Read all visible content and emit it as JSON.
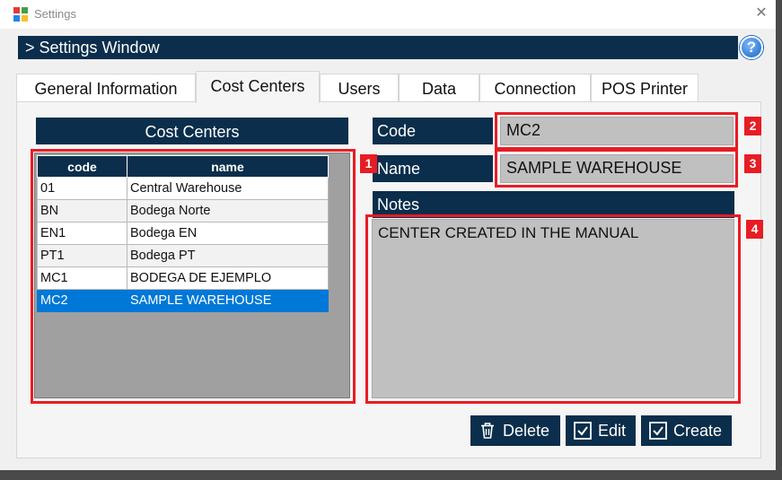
{
  "window": {
    "title": "Settings",
    "close_glyph": "✕"
  },
  "header": {
    "title": "> Settings Window",
    "help_label": "?"
  },
  "tabs": [
    {
      "label": "General Information"
    },
    {
      "label": "Cost Centers"
    },
    {
      "label": "Users"
    },
    {
      "label": "Data"
    },
    {
      "label": "Connection"
    },
    {
      "label": "POS Printer"
    }
  ],
  "active_tab": "Cost Centers",
  "cost_centers": {
    "title": "Cost Centers",
    "columns": [
      "code",
      "name"
    ],
    "rows": [
      {
        "code": "01",
        "name": "Central Warehouse"
      },
      {
        "code": "BN",
        "name": "Bodega Norte"
      },
      {
        "code": "EN1",
        "name": "Bodega EN"
      },
      {
        "code": "PT1",
        "name": "Bodega PT"
      },
      {
        "code": "MC1",
        "name": "BODEGA DE EJEMPLO"
      },
      {
        "code": "MC2",
        "name": "SAMPLE WAREHOUSE"
      }
    ],
    "selected_code": "MC2"
  },
  "form": {
    "code_label": "Code",
    "code_value": "MC2",
    "name_label": "Name",
    "name_value": "SAMPLE WAREHOUSE",
    "notes_label": "Notes",
    "notes_value": "CENTER CREATED IN THE MANUAL"
  },
  "buttons": {
    "delete": "Delete",
    "edit": "Edit",
    "create": "Create"
  },
  "annotations": [
    "1",
    "2",
    "3",
    "4"
  ],
  "colors": {
    "navy": "#0a2e4b",
    "selection": "#0078d7",
    "field_bg": "#c0c0c0",
    "annotation_red": "#e81c24"
  }
}
